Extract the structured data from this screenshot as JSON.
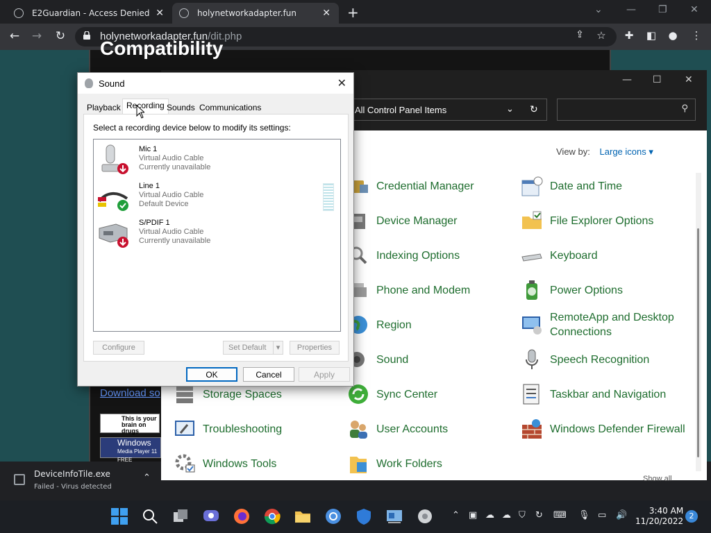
{
  "browser": {
    "tabs": [
      {
        "title": "E2Guardian - Access Denied"
      },
      {
        "title": "holynetworkadapter.fun"
      }
    ],
    "url_domain": "holynetworkadapter.fun",
    "url_path": "/dit.php"
  },
  "page": {
    "heading": "Compatibility",
    "link_text": "Download so",
    "badge1": "This is your brain on drugs",
    "badge2_main": "Windows",
    "badge2_sub": "Media Player 11",
    "badge2_free": "FREE"
  },
  "control_panel": {
    "breadcrumb": "All Control Panel Items",
    "view_by_label": "View by:",
    "view_by_value": "Large icons",
    "items": [
      {
        "label": "Credential Manager",
        "icon": "credential-manager-icon"
      },
      {
        "label": "Date and Time",
        "icon": "date-time-icon"
      },
      {
        "label": "Device Manager",
        "icon": "device-manager-icon"
      },
      {
        "label": "File Explorer Options",
        "icon": "folder-options-icon"
      },
      {
        "label": "Indexing Options",
        "icon": "indexing-icon"
      },
      {
        "label": "Keyboard",
        "icon": "keyboard-icon"
      },
      {
        "label": "Phone and Modem",
        "icon": "phone-modem-icon"
      },
      {
        "label": "Power Options",
        "icon": "power-options-icon"
      },
      {
        "label": "Region",
        "icon": "region-icon"
      },
      {
        "label": "RemoteApp and Desktop Connections",
        "icon": "remoteapp-icon"
      },
      {
        "label": "Sound",
        "icon": "sound-icon"
      },
      {
        "label": "Speech Recognition",
        "icon": "microphone-icon"
      },
      {
        "label": "Storage Spaces",
        "icon": "storage-spaces-icon"
      },
      {
        "label": "Sync Center",
        "icon": "sync-center-icon"
      },
      {
        "label": "Taskbar and Navigation",
        "icon": "taskbar-icon"
      },
      {
        "label": "Troubleshooting",
        "icon": "troubleshooting-icon"
      },
      {
        "label": "User Accounts",
        "icon": "user-accounts-icon"
      },
      {
        "label": "Windows Defender Firewall",
        "icon": "firewall-icon"
      },
      {
        "label": "Windows Tools",
        "icon": "windows-tools-icon"
      },
      {
        "label": "Work Folders",
        "icon": "work-folders-icon"
      }
    ]
  },
  "sound_dialog": {
    "title": "Sound",
    "tabs": [
      "Playback",
      "Recording",
      "Sounds",
      "Communications"
    ],
    "active_tab": "Recording",
    "instruction": "Select a recording device below to modify its settings:",
    "devices": [
      {
        "name": "Mic 1",
        "driver": "Virtual Audio Cable",
        "status": "Currently unavailable",
        "badge": "unavailable"
      },
      {
        "name": "Line 1",
        "driver": "Virtual Audio Cable",
        "status": "Default Device",
        "badge": "default"
      },
      {
        "name": "S/PDIF 1",
        "driver": "Virtual Audio Cable",
        "status": "Currently unavailable",
        "badge": "unavailable"
      }
    ],
    "buttons": {
      "configure": "Configure",
      "set_default": "Set Default",
      "properties": "Properties",
      "ok": "OK",
      "cancel": "Cancel",
      "apply": "Apply"
    }
  },
  "download": {
    "filename": "DeviceInfoTile.exe",
    "status": "Failed - Virus detected",
    "show_all": "Show all"
  },
  "taskbar": {
    "time": "3:40 AM",
    "date": "11/20/2022",
    "notifications": "2"
  },
  "colors": {
    "cp_link": "#1e6d2e",
    "accent": "#0067c0",
    "page_bg": "#1f4e52"
  }
}
